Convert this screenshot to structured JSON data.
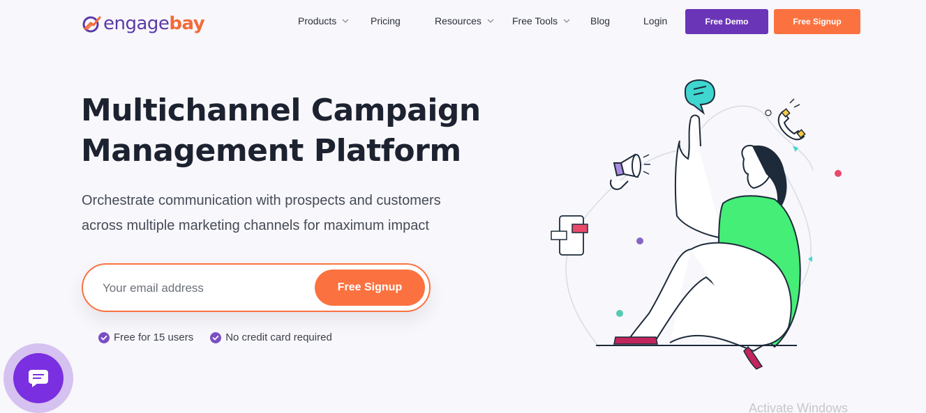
{
  "brand": {
    "part1": "engage",
    "part2": "bay"
  },
  "nav": {
    "products": "Products",
    "pricing": "Pricing",
    "resources": "Resources",
    "free_tools": "Free Tools",
    "blog": "Blog",
    "login": "Login",
    "free_demo": "Free Demo",
    "free_signup": "Free Signup"
  },
  "hero": {
    "title_line1": "Multichannel Campaign",
    "title_line2": "Management Platform",
    "subtitle_line1": "Orchestrate communication with prospects and customers",
    "subtitle_line2": "across multiple marketing channels for maximum impact"
  },
  "signup": {
    "placeholder": "Your email address",
    "button": "Free Signup"
  },
  "perks": [
    "Free for 15 users",
    "No credit card required"
  ],
  "watermark": "Activate Windows",
  "colors": {
    "primary_purple": "#6b35b8",
    "accent_orange": "#fb7240",
    "shirt_green": "#45ee77"
  },
  "icons": {
    "logo": "engagebay-logo-icon",
    "dropdown": "chevron-down-icon",
    "check": "check-circle-icon",
    "chat": "chat-icon"
  }
}
